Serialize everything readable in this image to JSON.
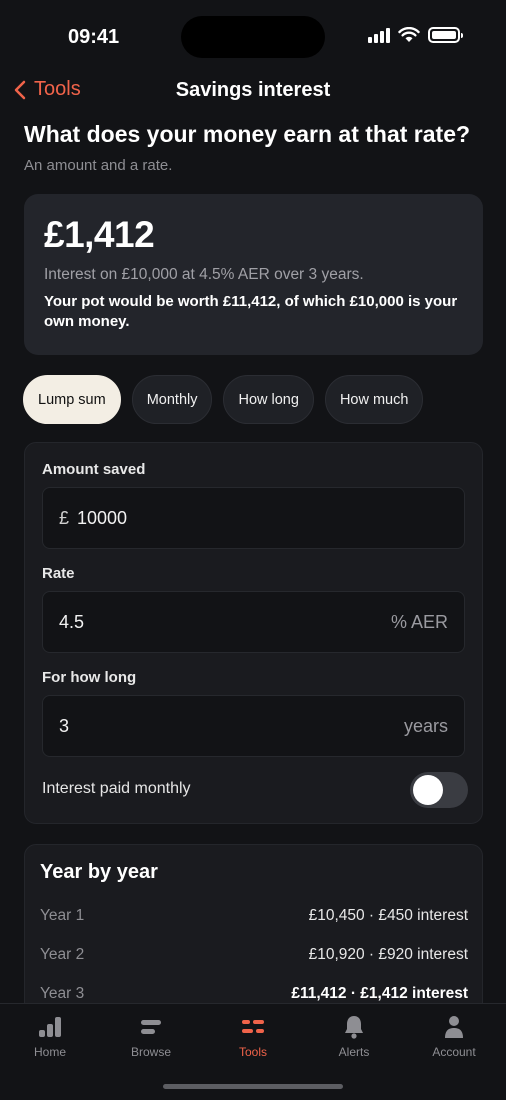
{
  "status_bar": {
    "time": "09:41"
  },
  "nav": {
    "back_label": "Tools",
    "title": "Savings interest"
  },
  "header": {
    "headline": "What does your money earn at that rate?",
    "subline": "An amount and a rate."
  },
  "result": {
    "amount": "£1,412",
    "detail": "Interest on £10,000 at 4.5% AER over 3 years.",
    "summary": "Your pot would be worth £11,412, of which £10,000 is your own money."
  },
  "tabs": [
    {
      "label": "Lump sum",
      "active": true
    },
    {
      "label": "Monthly",
      "active": false
    },
    {
      "label": "How long",
      "active": false
    },
    {
      "label": "How much",
      "active": false
    }
  ],
  "form": {
    "amount": {
      "label": "Amount saved",
      "prefix": "£",
      "value": "10000"
    },
    "rate": {
      "label": "Rate",
      "value": "4.5",
      "suffix": "% AER"
    },
    "term": {
      "label": "For how long",
      "value": "3",
      "suffix": "years"
    },
    "monthly_toggle": {
      "label": "Interest paid monthly",
      "on": false
    }
  },
  "year_by_year": {
    "title": "Year by year",
    "rows": [
      {
        "year": "Year 1",
        "value": "£10,450 · £450 interest"
      },
      {
        "year": "Year 2",
        "value": "£10,920 · £920 interest"
      },
      {
        "year": "Year 3",
        "value": "£11,412 · £1,412 interest"
      }
    ]
  },
  "tab_bar": [
    {
      "label": "Home",
      "icon": "bar-chart-icon",
      "active": false
    },
    {
      "label": "Browse",
      "icon": "browse-icon",
      "active": false
    },
    {
      "label": "Tools",
      "icon": "tools-icon",
      "active": true
    },
    {
      "label": "Alerts",
      "icon": "bell-icon",
      "active": false
    },
    {
      "label": "Account",
      "icon": "person-icon",
      "active": false
    }
  ],
  "colors": {
    "accent": "#f0634a",
    "background": "#121316",
    "card": "#23252b",
    "active_tab": "#f3eee4"
  }
}
